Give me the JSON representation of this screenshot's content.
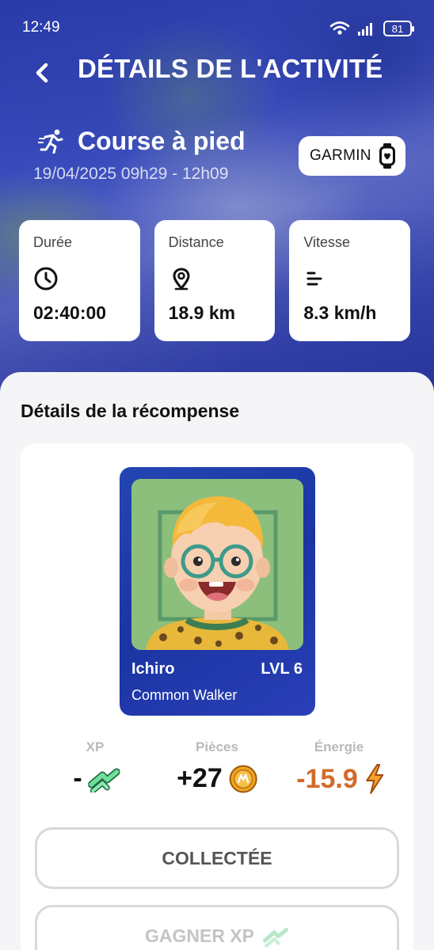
{
  "status_bar": {
    "time": "12:49",
    "battery": "81"
  },
  "header": {
    "title": "DÉTAILS DE L'ACTIVITÉ"
  },
  "activity": {
    "name": "Course à pied",
    "date": "19/04/2025 09h29 - 12h09",
    "source": "GARMIN"
  },
  "stats": [
    {
      "label": "Durée",
      "value": "02:40:00",
      "icon": "clock-icon"
    },
    {
      "label": "Distance",
      "value": "18.9 km",
      "icon": "location-pin-icon"
    },
    {
      "label": "Vitesse",
      "value": "8.3 km/h",
      "icon": "speed-lines-icon"
    }
  ],
  "reward": {
    "section_title": "Détails de la récompense",
    "avatar": {
      "name": "Ichiro",
      "level": "LVL 6",
      "class": "Common Walker"
    },
    "items": [
      {
        "label": "XP",
        "value": "-",
        "icon": "xp-chevrons-icon"
      },
      {
        "label": "Pièces",
        "value": "+27",
        "icon": "coin-icon"
      },
      {
        "label": "Énergie",
        "value": "-15.9",
        "icon": "lightning-icon"
      }
    ],
    "collect_button": "COLLECTÉE",
    "earn_xp_button": "GAGNER XP"
  },
  "colors": {
    "hero_blue": "#2b3fb2",
    "card_blue": "#2346b3",
    "energy_orange": "#d26a2a",
    "xp_green": "#5dd48a",
    "coin_gold": "#f0a623"
  }
}
